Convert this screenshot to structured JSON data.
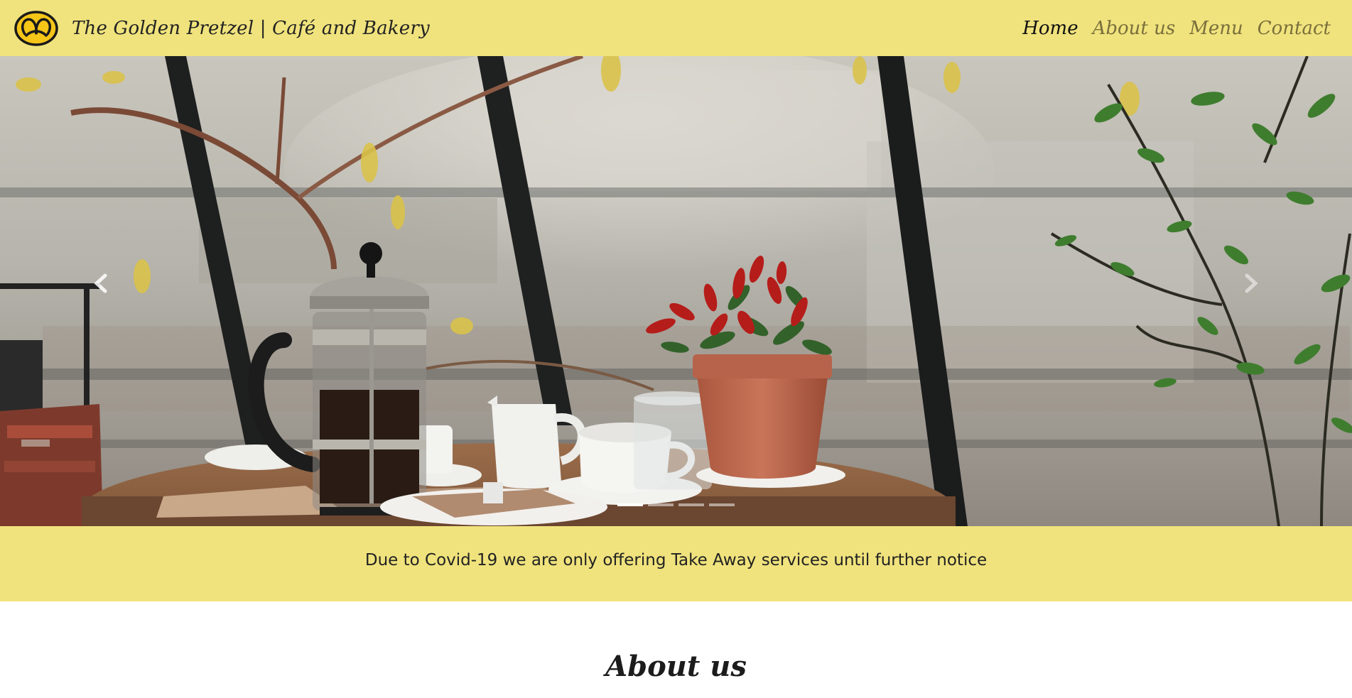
{
  "navbar": {
    "brand": "The Golden Pretzel | Café and Bakery",
    "links": [
      {
        "label": "Home",
        "active": true
      },
      {
        "label": "About us",
        "active": false
      },
      {
        "label": "Menu",
        "active": false
      },
      {
        "label": "Contact",
        "active": false
      }
    ]
  },
  "carousel": {
    "slide_count": 4,
    "active_index": 0,
    "prev_icon": "chevron-left-icon",
    "next_icon": "chevron-right-icon"
  },
  "notice": {
    "text": "Due to Covid-19 we are only offering Take Away services until further notice"
  },
  "about": {
    "heading": "About us"
  },
  "colors": {
    "accent": "#f0e37d",
    "logo_gold": "#f5c518",
    "text_dark": "#222222",
    "nav_inactive": "#7a6f3c"
  }
}
